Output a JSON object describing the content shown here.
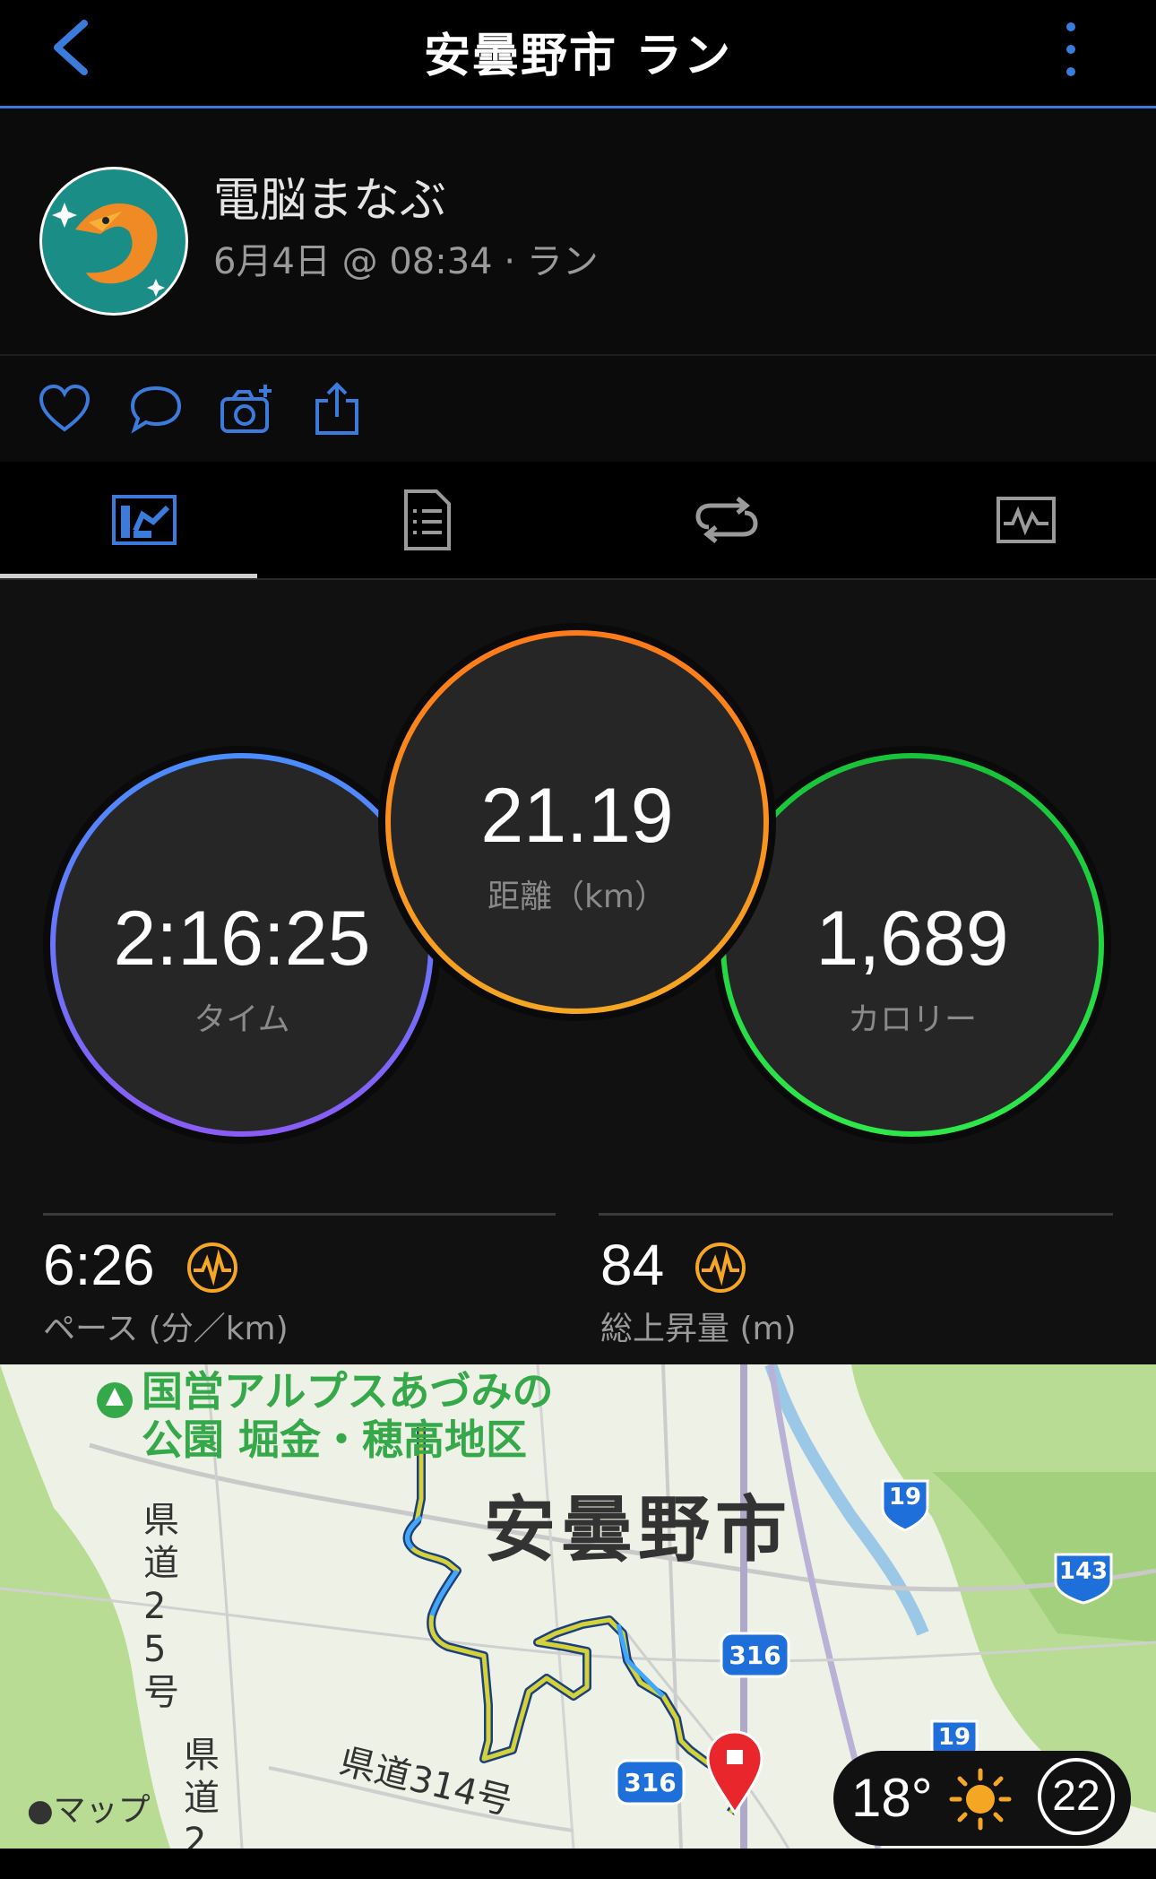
{
  "nav": {
    "title": "安曇野市 ラン",
    "back_icon": "chevron-left-icon",
    "more_icon": "kebab-menu-icon"
  },
  "profile": {
    "name": "電脳まなぶ",
    "meta": "6月4日 @ 08:34 · ラン"
  },
  "actions": [
    {
      "name": "like",
      "icon": "heart-icon"
    },
    {
      "name": "comment",
      "icon": "speech-bubble-icon"
    },
    {
      "name": "add-photo",
      "icon": "camera-plus-icon"
    },
    {
      "name": "share",
      "icon": "share-icon"
    }
  ],
  "tabs": [
    {
      "name": "overview",
      "icon": "overview-icon",
      "active": true
    },
    {
      "name": "details",
      "icon": "document-icon",
      "active": false
    },
    {
      "name": "laps",
      "icon": "loop-icon",
      "active": false
    },
    {
      "name": "charts",
      "icon": "chart-icon",
      "active": false
    }
  ],
  "rings": {
    "time": {
      "value": "2:16:25",
      "label": "タイム"
    },
    "distance": {
      "value": "21.19",
      "label": "距離（km）"
    },
    "calories": {
      "value": "1,689",
      "label": "カロリー"
    }
  },
  "metrics": {
    "pace": {
      "value": "6:26",
      "label": "ペース (分／km)"
    },
    "elevation": {
      "value": "84",
      "label": "総上昇量 (m)"
    }
  },
  "map": {
    "park_label_1": "国営アルプスあづみの",
    "park_label_2": "公園 堀金・穂高地区",
    "city_label": "安曇野市",
    "road_25": "県道25号",
    "road_2": "県道2",
    "road_314": "県道314号",
    "shields": [
      "19",
      "143",
      "316",
      "316",
      "19"
    ],
    "logo": "マップ",
    "weather_temp": "18°",
    "aqi": "22"
  },
  "colors": {
    "accent": "#3b7bdc",
    "time_ring": [
      "#4a8dff",
      "#8a5cf6"
    ],
    "distance_ring": [
      "#ff7a1a",
      "#f5a623"
    ],
    "calorie_ring": [
      "#18c23a",
      "#2ee84a"
    ],
    "metric_icon": "#f5a623"
  }
}
